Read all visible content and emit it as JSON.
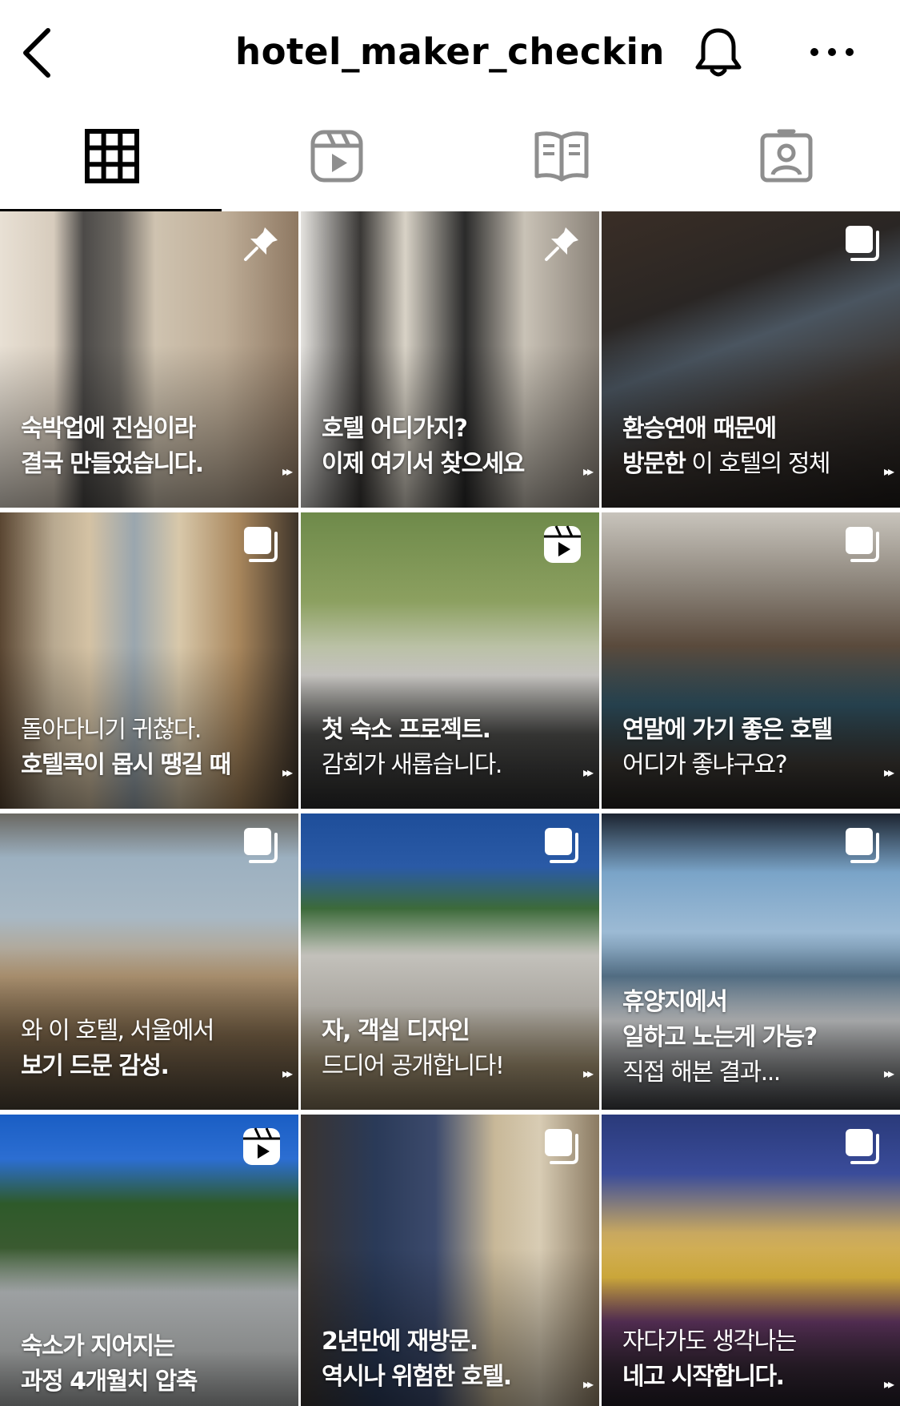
{
  "header": {
    "username": "hotel_maker_checkin"
  },
  "icons": {
    "back": "chevron-left-icon",
    "bell": "bell-icon",
    "more": "more-horizontal-icon",
    "tab_grid": "grid-icon",
    "tab_reels": "reels-icon",
    "tab_guides": "guide-book-icon",
    "tab_tagged": "tagged-person-icon"
  },
  "posts": [
    {
      "line1": "숙박업에 진심이라",
      "line2": "결국 만들었습니다.",
      "badge": "pin"
    },
    {
      "line1": "호텔 어디가지?",
      "line2": "이제 여기서 찾으세요",
      "badge": "pin"
    },
    {
      "line1": "환승연애 때문에",
      "line2a": "방문한",
      "line2b": " 이 호텔의 정체",
      "badge": "carousel"
    },
    {
      "line1": "돌아다니기 귀찮다.",
      "line2": "호텔콕이 몹시 땡길 때",
      "badge": "carousel"
    },
    {
      "line1": "첫 숙소 프로젝트.",
      "line2": "감회가 새롭습니다.",
      "badge": "reel"
    },
    {
      "line1": "연말에 가기 좋은 호텔",
      "line2": "어디가 좋냐구요?",
      "badge": "carousel"
    },
    {
      "line1": "와 이 호텔, 서울에서",
      "line2": "보기 드문 감성.",
      "badge": "carousel"
    },
    {
      "line1": "자, 객실 디자인",
      "line2": "드디어 공개합니다!",
      "badge": "carousel"
    },
    {
      "line1": "휴양지에서",
      "line2": "일하고 노는게 가능?",
      "line3": "직접 해본 결과...",
      "badge": "carousel"
    },
    {
      "line1": "숙소가 지어지는",
      "line2": "과정 4개월치 압축",
      "badge": "reel"
    },
    {
      "line1": "2년만에 재방문.",
      "line2": "역시나 위험한 호텔.",
      "badge": "carousel"
    },
    {
      "line1": "자다가도 생각나는",
      "line2": "네고 시작합니다.",
      "badge": "carousel"
    }
  ],
  "colors": {
    "background": "#ffffff",
    "text": "#000000",
    "tab_inactive": "#8e8e8e",
    "caption": "#ffffff"
  }
}
